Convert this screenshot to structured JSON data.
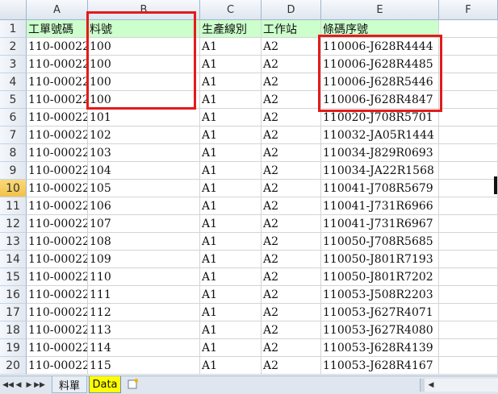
{
  "columns": [
    "A",
    "B",
    "C",
    "D",
    "E",
    "F"
  ],
  "row_numbers": [
    "1",
    "2",
    "3",
    "4",
    "5",
    "6",
    "7",
    "8",
    "9",
    "10",
    "11",
    "12",
    "13",
    "14",
    "15",
    "16",
    "17",
    "18",
    "19",
    "20"
  ],
  "active_row": "10",
  "header": [
    "工單號碼",
    "料號",
    "生產線別",
    "工作站",
    "條碼序號"
  ],
  "rows": [
    [
      "110-00022",
      "100",
      "A1",
      "A2",
      "110006-J628R4444"
    ],
    [
      "110-00022",
      "100",
      "A1",
      "A2",
      "110006-J628R4485"
    ],
    [
      "110-00022",
      "100",
      "A1",
      "A2",
      "110006-J628R5446"
    ],
    [
      "110-00022",
      "100",
      "A1",
      "A2",
      "110006-J628R4847"
    ],
    [
      "110-00022",
      "101",
      "A1",
      "A2",
      "110020-J708R5701"
    ],
    [
      "110-00022",
      "102",
      "A1",
      "A2",
      "110032-JA05R1444"
    ],
    [
      "110-00022",
      "103",
      "A1",
      "A2",
      "110034-J829R0693"
    ],
    [
      "110-00022",
      "104",
      "A1",
      "A2",
      "110034-JA22R1568"
    ],
    [
      "110-00022",
      "105",
      "A1",
      "A2",
      "110041-J708R5679"
    ],
    [
      "110-00022",
      "106",
      "A1",
      "A2",
      "110041-J731R6966"
    ],
    [
      "110-00022",
      "107",
      "A1",
      "A2",
      "110041-J731R6967"
    ],
    [
      "110-00022",
      "108",
      "A1",
      "A2",
      "110050-J708R5685"
    ],
    [
      "110-00022",
      "109",
      "A1",
      "A2",
      "110050-J801R7193"
    ],
    [
      "110-00022",
      "110",
      "A1",
      "A2",
      "110050-J801R7202"
    ],
    [
      "110-00022",
      "111",
      "A1",
      "A2",
      "110053-J508R2203"
    ],
    [
      "110-00022",
      "112",
      "A1",
      "A2",
      "110053-J627R4071"
    ],
    [
      "110-00022",
      "113",
      "A1",
      "A2",
      "110053-J627R4080"
    ],
    [
      "110-00022",
      "114",
      "A1",
      "A2",
      "110053-J628R4139"
    ],
    [
      "110-00022",
      "115",
      "A1",
      "A2",
      "110053-J628R4167"
    ]
  ],
  "sheet_tabs": {
    "nav": [
      "◀◀",
      "◀",
      "▶",
      "▶▶"
    ],
    "tab1": "料單",
    "tab2": "Data",
    "new_sheet_icon": "new-sheet-icon"
  },
  "colors": {
    "header_fill": "#ccffcc",
    "active_tab": "#ffff00",
    "highlight_box": "#e31b1b"
  }
}
